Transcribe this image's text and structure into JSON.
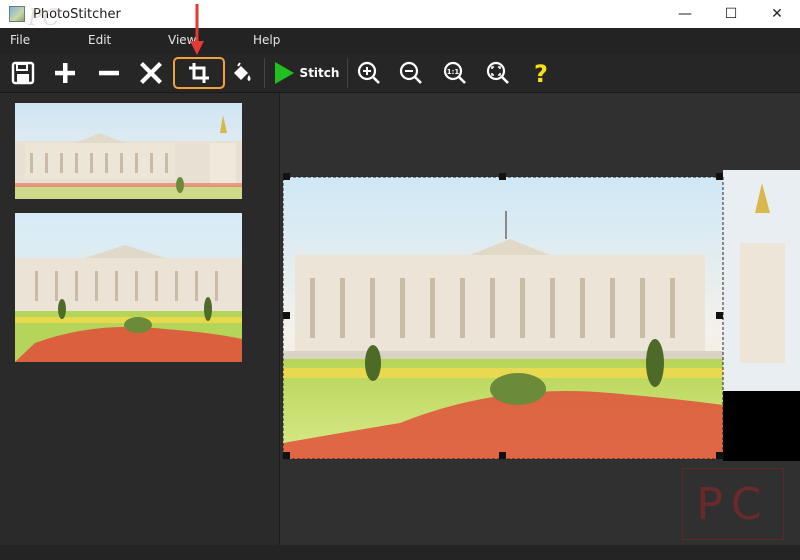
{
  "window": {
    "title": "PhotoStitcher",
    "controls": {
      "minimize": "—",
      "maximize": "☐",
      "close": "✕"
    }
  },
  "menu": {
    "items": [
      "File",
      "Edit",
      "View",
      "Help"
    ]
  },
  "toolbar": {
    "buttons": [
      {
        "name": "save",
        "icon": "floppy-icon"
      },
      {
        "name": "add",
        "icon": "plus-icon"
      },
      {
        "name": "remove",
        "icon": "minus-icon"
      },
      {
        "name": "clear",
        "icon": "x-icon"
      },
      {
        "name": "crop",
        "icon": "crop-icon",
        "active": true
      },
      {
        "name": "fill",
        "icon": "paint-bucket-icon"
      },
      {
        "name": "stitch",
        "icon": "play-icon",
        "label": "Stitch"
      },
      {
        "name": "zoom-in",
        "icon": "zoom-in-icon"
      },
      {
        "name": "zoom-out",
        "icon": "zoom-out-icon"
      },
      {
        "name": "zoom-actual",
        "icon": "zoom-1to1-icon",
        "text": "1:1"
      },
      {
        "name": "zoom-fit",
        "icon": "zoom-fit-icon"
      },
      {
        "name": "help",
        "icon": "question-icon",
        "text": "?"
      }
    ],
    "stitch_label": "Stitch",
    "zoom_actual_text": "1:1",
    "help_text": "?"
  },
  "sidebar": {
    "thumbnails": [
      {
        "name": "thumbnail-1",
        "subject": "palace-with-monument"
      },
      {
        "name": "thumbnail-2",
        "subject": "palace-with-flowers"
      }
    ]
  },
  "watermark": {
    "text": "PC",
    "top_text": "PC"
  },
  "colors": {
    "accent_highlight": "#f2a23a",
    "stitch_green": "#1fc01f",
    "help_yellow": "#f5e11a",
    "annotation_red": "#e53935",
    "background_dark": "#2b2b2b"
  }
}
